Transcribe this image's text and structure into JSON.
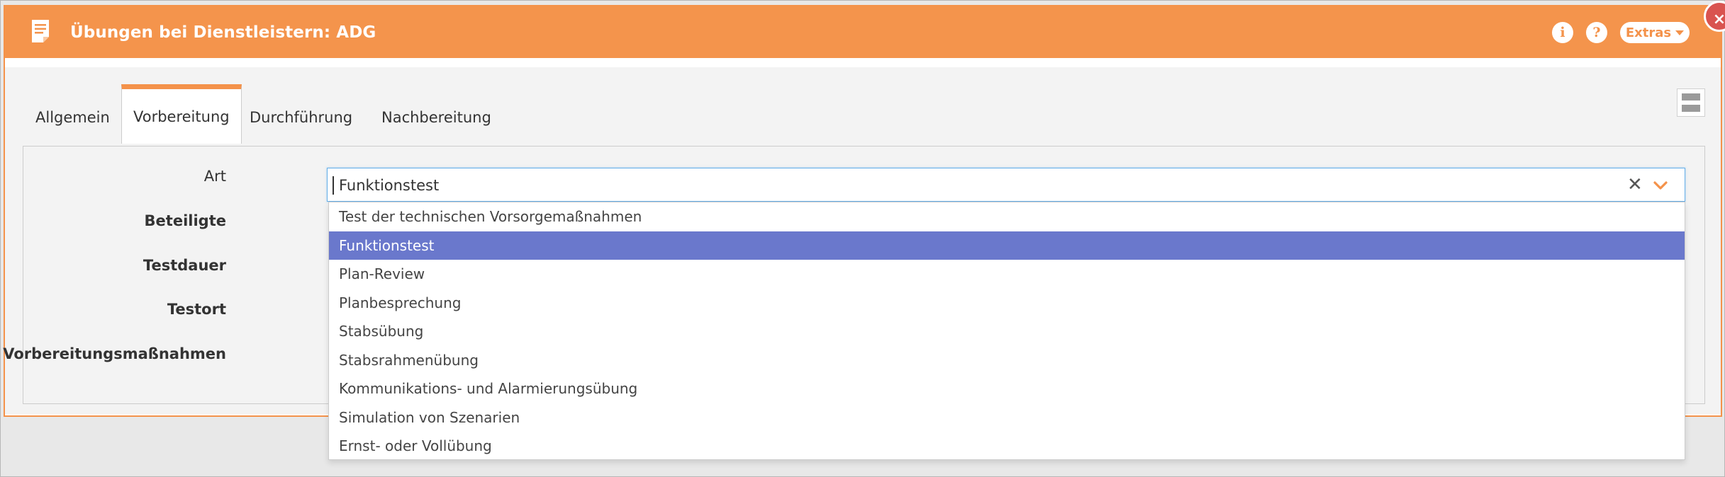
{
  "dialog": {
    "title": "Übungen bei Dienstleistern: ADG",
    "info_glyph": "i",
    "help_glyph": "?",
    "extras_label": "Extras",
    "close_glyph": "×"
  },
  "tabs": [
    {
      "label": "Allgemein"
    },
    {
      "label": "Vorbereitung",
      "active": true
    },
    {
      "label": "Durchführung"
    },
    {
      "label": "Nachbereitung"
    }
  ],
  "form": {
    "labels": [
      "Art",
      "Beteiligte",
      "Testdauer",
      "Testort",
      "Vorbereitungsmaßnahmen"
    ],
    "art_value": "Funktionstest",
    "clear_glyph": "✕"
  },
  "dropdown": {
    "options": [
      "Test der technischen Vorsorgemaßnahmen",
      "Funktionstest",
      "Plan-Review",
      "Planbesprechung",
      "Stabsübung",
      "Stabsrahmenübung",
      "Kommunikations- und Alarmierungsübung",
      "Simulation von Szenarien",
      "Ernst- oder Vollübung"
    ],
    "selected_index": 1
  },
  "colors": {
    "header": "#f4944c",
    "accent": "#f4924a",
    "selected_option": "#6a78cc",
    "focus_border": "#66afe9"
  },
  "icons": [
    "document-icon",
    "info-icon",
    "help-icon",
    "caret-down-icon",
    "close-icon",
    "layout-toggle-icon",
    "clear-icon",
    "chevron-down-icon"
  ]
}
